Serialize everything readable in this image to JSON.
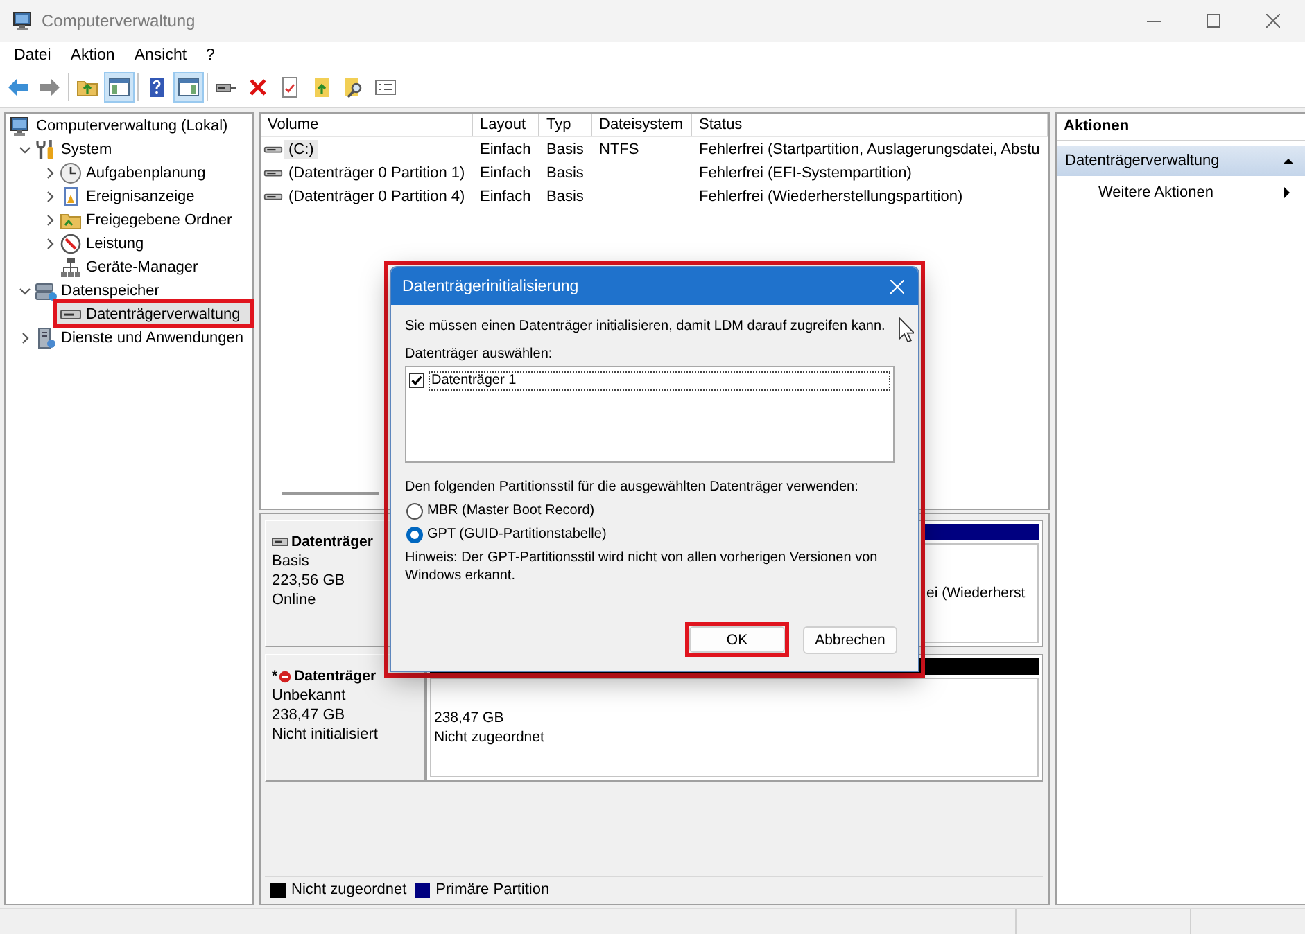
{
  "window": {
    "title": "Computerverwaltung"
  },
  "menu": [
    "Datei",
    "Aktion",
    "Ansicht",
    "?"
  ],
  "toolbar": [
    [
      {
        "pressed": false
      },
      {
        "pressed": false
      }
    ],
    [
      {
        "pressed": false
      },
      {
        "pressed": true
      }
    ],
    [
      {
        "pressed": false
      },
      {
        "pressed": true
      }
    ],
    [
      {
        "pressed": false
      },
      {
        "pressed": false
      },
      {
        "pressed": false
      },
      {
        "pressed": false
      },
      {
        "pressed": false
      },
      {
        "pressed": false
      }
    ]
  ],
  "tree": [
    {
      "label": "Computerverwaltung (Lokal)",
      "selected": false,
      "highlighted": false,
      "children": [
        {
          "label": "System",
          "expanded": true,
          "selected": false,
          "highlighted": false,
          "children": [
            {
              "label": "Aufgabenplanung",
              "expanded": false,
              "selected": false,
              "highlighted": false
            },
            {
              "label": "Ereignisanzeige",
              "expanded": false,
              "selected": false,
              "highlighted": false
            },
            {
              "label": "Freigegebene Ordner",
              "expanded": false,
              "selected": false,
              "highlighted": false
            },
            {
              "label": "Leistung",
              "expanded": false,
              "selected": false,
              "highlighted": false
            },
            {
              "label": "Geräte-Manager",
              "selected": false,
              "highlighted": false
            }
          ]
        },
        {
          "label": "Datenspeicher",
          "expanded": true,
          "selected": false,
          "highlighted": false,
          "children": [
            {
              "label": "Datenträgerverwaltung",
              "selected": true,
              "highlighted": true
            }
          ]
        },
        {
          "label": "Dienste und Anwendungen",
          "expanded": false,
          "selected": false,
          "highlighted": false
        }
      ]
    }
  ],
  "table": {
    "columns": [
      "Volume",
      "Layout",
      "Typ",
      "Dateisystem",
      "Status"
    ],
    "rows": [
      {
        "selected": true,
        "volume": "(C:)",
        "layout": "Einfach",
        "type": "Basis",
        "file_system": "NTFS",
        "status": "Fehlerfrei (Startpartition, Auslagerungsdatei, Abstu"
      },
      {
        "selected": false,
        "volume": "(Datenträger 0 Partition 1)",
        "layout": "Einfach",
        "type": "Basis",
        "status": "Fehlerfrei (EFI-Systempartition)"
      },
      {
        "selected": false,
        "volume": "(Datenträger 0 Partition 4)",
        "layout": "Einfach",
        "type": "Basis",
        "status": "Fehlerfrei (Wiederherstellungspartition)"
      }
    ]
  },
  "disks": [
    {
      "kind": "basic",
      "title": "Datenträger",
      "lines": [
        "Basis",
        "223,56 GB",
        "Online"
      ],
      "covered": true,
      "partitions": [
        {
          "color": "#000080",
          "lines": [
            "ei (Wiederherst"
          ]
        }
      ]
    },
    {
      "kind": "uninitialized",
      "marker": "*",
      "title": "Datenträger",
      "lines": [
        "Unbekannt",
        "238,47 GB",
        "Nicht initialisiert"
      ],
      "covered": false,
      "partitions": [
        {
          "color": "#000000",
          "lines": [
            "238,47 GB",
            "Nicht zugeordnet"
          ]
        }
      ]
    }
  ],
  "legend": [
    {
      "label": "Nicht zugeordnet",
      "color": "#000000"
    },
    {
      "label": "Primäre Partition",
      "color": "#000080"
    }
  ],
  "actions": {
    "title": "Aktionen",
    "sections": [
      {
        "label": "Datenträgerverwaltung",
        "expanded": true,
        "items": [
          {
            "label": "Weitere Aktionen",
            "submenu": true
          }
        ]
      }
    ]
  },
  "dialog": {
    "title": "Datenträgerinitialisierung",
    "highlighted": true,
    "message": "Sie müssen einen Datenträger initialisieren, damit LDM darauf zugreifen kann.",
    "list_label": "Datenträger auswählen:",
    "disks": [
      {
        "label": "Datenträger 1",
        "checked": true,
        "focused": true
      }
    ],
    "style_label": "Den folgenden Partitionsstil für die ausgewählten Datenträger verwenden:",
    "styles": [
      {
        "label": "MBR (Master Boot Record)",
        "selected": false
      },
      {
        "label": "GPT (GUID-Partitionstabelle)",
        "selected": true
      }
    ],
    "note": "Hinweis: Der GPT-Partitionsstil wird nicht von allen vorherigen Versionen von Windows erkannt.",
    "buttons": [
      {
        "label": "OK",
        "highlighted": true
      },
      {
        "label": "Abbrechen",
        "highlighted": false
      }
    ]
  }
}
